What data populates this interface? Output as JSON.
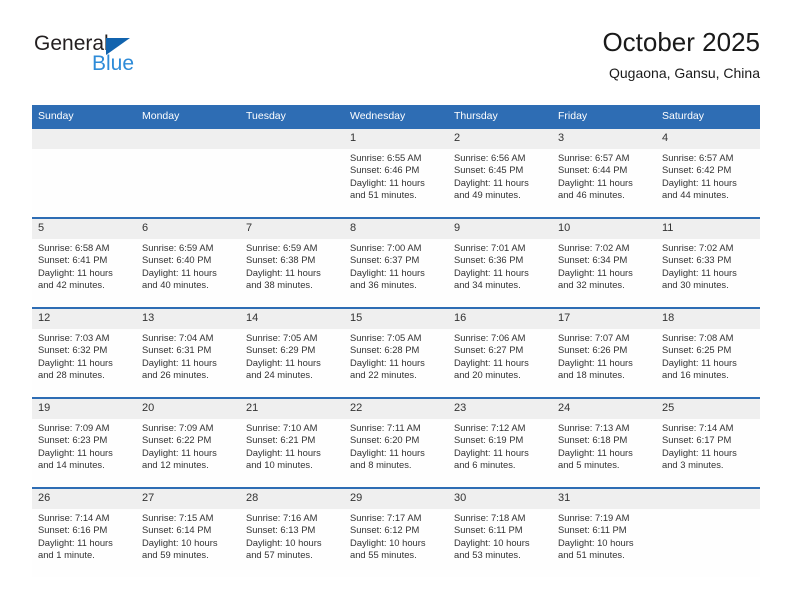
{
  "brand": {
    "name_top": "General",
    "name_bottom": "Blue",
    "triangle_color": "#1163AE",
    "top_color": "#231F20",
    "bottom_color": "#2E8BD8"
  },
  "header": {
    "title": "October 2025",
    "subtitle": "Qugaona, Gansu, China"
  },
  "theme": {
    "header_blue": "#2E6DB4",
    "daynum_bg": "#EFEFEF",
    "cell_bg": "#FEFEFE",
    "text": "#333333"
  },
  "weekday_headers": [
    "Sunday",
    "Monday",
    "Tuesday",
    "Wednesday",
    "Thursday",
    "Friday",
    "Saturday"
  ],
  "weeks": [
    [
      {
        "day": "",
        "sunrise": "",
        "sunset": "",
        "daylight_a": "",
        "daylight_b": "",
        "blank": true
      },
      {
        "day": "",
        "sunrise": "",
        "sunset": "",
        "daylight_a": "",
        "daylight_b": "",
        "blank": true
      },
      {
        "day": "",
        "sunrise": "",
        "sunset": "",
        "daylight_a": "",
        "daylight_b": "",
        "blank": true
      },
      {
        "day": "1",
        "sunrise": "Sunrise: 6:55 AM",
        "sunset": "Sunset: 6:46 PM",
        "daylight_a": "Daylight: 11 hours",
        "daylight_b": "and 51 minutes."
      },
      {
        "day": "2",
        "sunrise": "Sunrise: 6:56 AM",
        "sunset": "Sunset: 6:45 PM",
        "daylight_a": "Daylight: 11 hours",
        "daylight_b": "and 49 minutes."
      },
      {
        "day": "3",
        "sunrise": "Sunrise: 6:57 AM",
        "sunset": "Sunset: 6:44 PM",
        "daylight_a": "Daylight: 11 hours",
        "daylight_b": "and 46 minutes."
      },
      {
        "day": "4",
        "sunrise": "Sunrise: 6:57 AM",
        "sunset": "Sunset: 6:42 PM",
        "daylight_a": "Daylight: 11 hours",
        "daylight_b": "and 44 minutes."
      }
    ],
    [
      {
        "day": "5",
        "sunrise": "Sunrise: 6:58 AM",
        "sunset": "Sunset: 6:41 PM",
        "daylight_a": "Daylight: 11 hours",
        "daylight_b": "and 42 minutes."
      },
      {
        "day": "6",
        "sunrise": "Sunrise: 6:59 AM",
        "sunset": "Sunset: 6:40 PM",
        "daylight_a": "Daylight: 11 hours",
        "daylight_b": "and 40 minutes."
      },
      {
        "day": "7",
        "sunrise": "Sunrise: 6:59 AM",
        "sunset": "Sunset: 6:38 PM",
        "daylight_a": "Daylight: 11 hours",
        "daylight_b": "and 38 minutes."
      },
      {
        "day": "8",
        "sunrise": "Sunrise: 7:00 AM",
        "sunset": "Sunset: 6:37 PM",
        "daylight_a": "Daylight: 11 hours",
        "daylight_b": "and 36 minutes."
      },
      {
        "day": "9",
        "sunrise": "Sunrise: 7:01 AM",
        "sunset": "Sunset: 6:36 PM",
        "daylight_a": "Daylight: 11 hours",
        "daylight_b": "and 34 minutes."
      },
      {
        "day": "10",
        "sunrise": "Sunrise: 7:02 AM",
        "sunset": "Sunset: 6:34 PM",
        "daylight_a": "Daylight: 11 hours",
        "daylight_b": "and 32 minutes."
      },
      {
        "day": "11",
        "sunrise": "Sunrise: 7:02 AM",
        "sunset": "Sunset: 6:33 PM",
        "daylight_a": "Daylight: 11 hours",
        "daylight_b": "and 30 minutes."
      }
    ],
    [
      {
        "day": "12",
        "sunrise": "Sunrise: 7:03 AM",
        "sunset": "Sunset: 6:32 PM",
        "daylight_a": "Daylight: 11 hours",
        "daylight_b": "and 28 minutes."
      },
      {
        "day": "13",
        "sunrise": "Sunrise: 7:04 AM",
        "sunset": "Sunset: 6:31 PM",
        "daylight_a": "Daylight: 11 hours",
        "daylight_b": "and 26 minutes."
      },
      {
        "day": "14",
        "sunrise": "Sunrise: 7:05 AM",
        "sunset": "Sunset: 6:29 PM",
        "daylight_a": "Daylight: 11 hours",
        "daylight_b": "and 24 minutes."
      },
      {
        "day": "15",
        "sunrise": "Sunrise: 7:05 AM",
        "sunset": "Sunset: 6:28 PM",
        "daylight_a": "Daylight: 11 hours",
        "daylight_b": "and 22 minutes."
      },
      {
        "day": "16",
        "sunrise": "Sunrise: 7:06 AM",
        "sunset": "Sunset: 6:27 PM",
        "daylight_a": "Daylight: 11 hours",
        "daylight_b": "and 20 minutes."
      },
      {
        "day": "17",
        "sunrise": "Sunrise: 7:07 AM",
        "sunset": "Sunset: 6:26 PM",
        "daylight_a": "Daylight: 11 hours",
        "daylight_b": "and 18 minutes."
      },
      {
        "day": "18",
        "sunrise": "Sunrise: 7:08 AM",
        "sunset": "Sunset: 6:25 PM",
        "daylight_a": "Daylight: 11 hours",
        "daylight_b": "and 16 minutes."
      }
    ],
    [
      {
        "day": "19",
        "sunrise": "Sunrise: 7:09 AM",
        "sunset": "Sunset: 6:23 PM",
        "daylight_a": "Daylight: 11 hours",
        "daylight_b": "and 14 minutes."
      },
      {
        "day": "20",
        "sunrise": "Sunrise: 7:09 AM",
        "sunset": "Sunset: 6:22 PM",
        "daylight_a": "Daylight: 11 hours",
        "daylight_b": "and 12 minutes."
      },
      {
        "day": "21",
        "sunrise": "Sunrise: 7:10 AM",
        "sunset": "Sunset: 6:21 PM",
        "daylight_a": "Daylight: 11 hours",
        "daylight_b": "and 10 minutes."
      },
      {
        "day": "22",
        "sunrise": "Sunrise: 7:11 AM",
        "sunset": "Sunset: 6:20 PM",
        "daylight_a": "Daylight: 11 hours",
        "daylight_b": "and 8 minutes."
      },
      {
        "day": "23",
        "sunrise": "Sunrise: 7:12 AM",
        "sunset": "Sunset: 6:19 PM",
        "daylight_a": "Daylight: 11 hours",
        "daylight_b": "and 6 minutes."
      },
      {
        "day": "24",
        "sunrise": "Sunrise: 7:13 AM",
        "sunset": "Sunset: 6:18 PM",
        "daylight_a": "Daylight: 11 hours",
        "daylight_b": "and 5 minutes."
      },
      {
        "day": "25",
        "sunrise": "Sunrise: 7:14 AM",
        "sunset": "Sunset: 6:17 PM",
        "daylight_a": "Daylight: 11 hours",
        "daylight_b": "and 3 minutes."
      }
    ],
    [
      {
        "day": "26",
        "sunrise": "Sunrise: 7:14 AM",
        "sunset": "Sunset: 6:16 PM",
        "daylight_a": "Daylight: 11 hours",
        "daylight_b": "and 1 minute."
      },
      {
        "day": "27",
        "sunrise": "Sunrise: 7:15 AM",
        "sunset": "Sunset: 6:14 PM",
        "daylight_a": "Daylight: 10 hours",
        "daylight_b": "and 59 minutes."
      },
      {
        "day": "28",
        "sunrise": "Sunrise: 7:16 AM",
        "sunset": "Sunset: 6:13 PM",
        "daylight_a": "Daylight: 10 hours",
        "daylight_b": "and 57 minutes."
      },
      {
        "day": "29",
        "sunrise": "Sunrise: 7:17 AM",
        "sunset": "Sunset: 6:12 PM",
        "daylight_a": "Daylight: 10 hours",
        "daylight_b": "and 55 minutes."
      },
      {
        "day": "30",
        "sunrise": "Sunrise: 7:18 AM",
        "sunset": "Sunset: 6:11 PM",
        "daylight_a": "Daylight: 10 hours",
        "daylight_b": "and 53 minutes."
      },
      {
        "day": "31",
        "sunrise": "Sunrise: 7:19 AM",
        "sunset": "Sunset: 6:11 PM",
        "daylight_a": "Daylight: 10 hours",
        "daylight_b": "and 51 minutes."
      },
      {
        "day": "",
        "sunrise": "",
        "sunset": "",
        "daylight_a": "",
        "daylight_b": "",
        "blank": true
      }
    ]
  ]
}
